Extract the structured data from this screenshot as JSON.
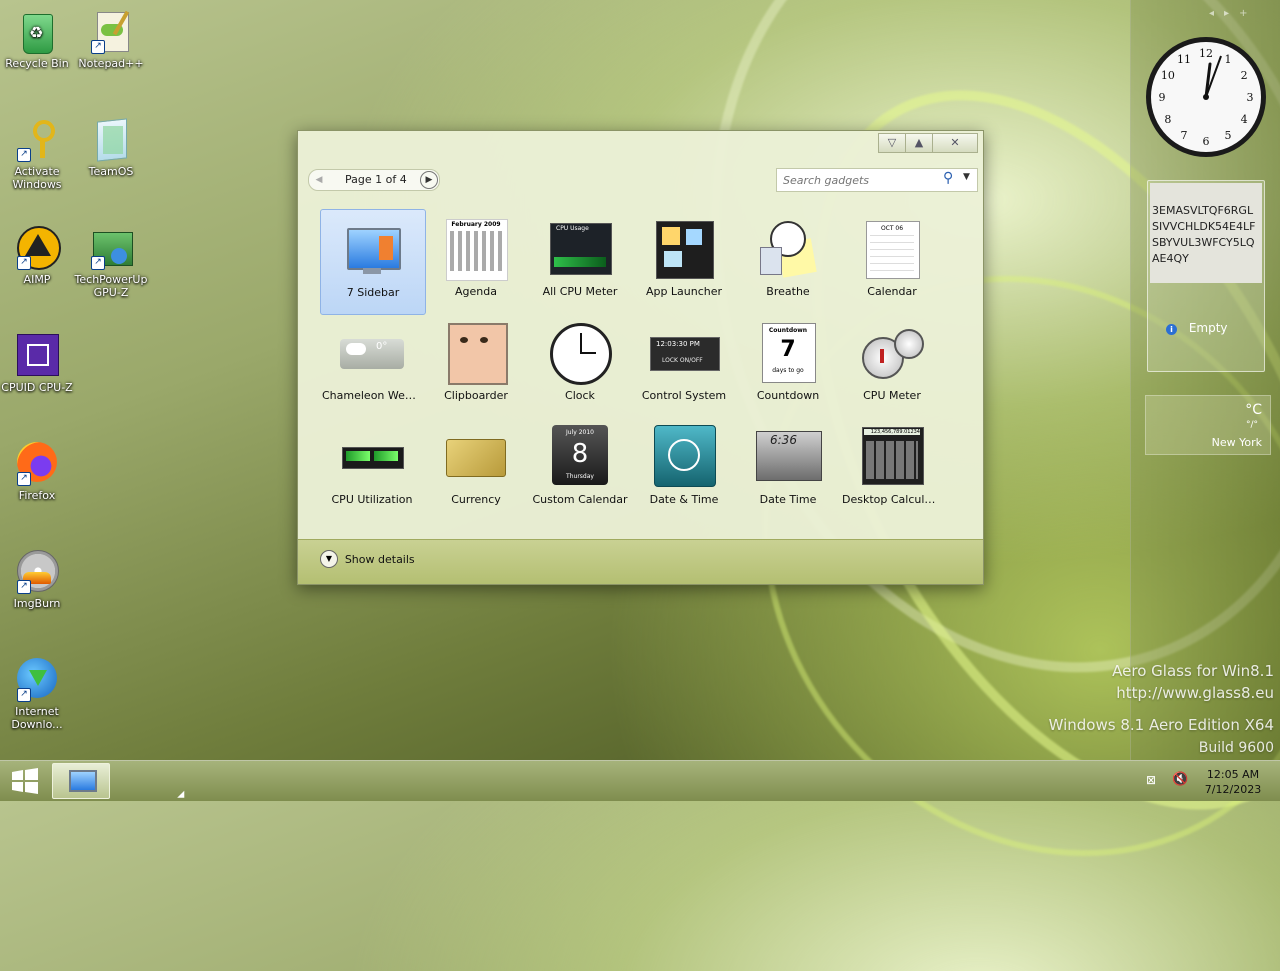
{
  "desktop": {
    "icons": [
      {
        "label": "Recycle Bin"
      },
      {
        "label": "Notepad++"
      },
      {
        "label": "Activate Windows"
      },
      {
        "label": "TeamOS"
      },
      {
        "label": "AIMP"
      },
      {
        "label": "TechPowerUp GPU-Z"
      },
      {
        "label": "CPUID CPU-Z"
      },
      {
        "label": "Firefox"
      },
      {
        "label": "ImgBurn"
      },
      {
        "label": "Internet Downlo..."
      }
    ]
  },
  "gadget_window": {
    "page_label": "Page 1 of 4",
    "search_placeholder": "Search gadgets",
    "gadgets": [
      {
        "label": "7 Sidebar",
        "selected": true
      },
      {
        "label": "Agenda"
      },
      {
        "label": "All CPU Meter"
      },
      {
        "label": "App Launcher"
      },
      {
        "label": "Breathe"
      },
      {
        "label": "Calendar"
      },
      {
        "label": "Chameleon Weat..."
      },
      {
        "label": "Clipboarder"
      },
      {
        "label": "Clock"
      },
      {
        "label": "Control System"
      },
      {
        "label": "Countdown"
      },
      {
        "label": "CPU Meter"
      },
      {
        "label": "CPU Utilization"
      },
      {
        "label": "Currency"
      },
      {
        "label": "Custom Calendar"
      },
      {
        "label": "Date & Time"
      },
      {
        "label": "Date Time"
      },
      {
        "label": "Desktop Calculator"
      }
    ],
    "show_details": "Show details",
    "thumb_text": {
      "agenda_month": "February 2009",
      "cpu_usage": "CPU Usage",
      "weather_temp": "0°",
      "control_time": "12:03:30 PM",
      "control_lock": "LOCK ON/OFF",
      "countdown_title": "Countdown",
      "countdown_num": "7",
      "countdown_sub": "days to go",
      "customcal_month": "July 2010",
      "customcal_num": "8",
      "customcal_day": "Thursday",
      "datetime_digits": "6:36",
      "calc_display": "123,456,789.01234",
      "calendar_month": "OCT 06"
    }
  },
  "sidebar": {
    "clock_numbers": [
      "12",
      "1",
      "2",
      "3",
      "4",
      "5",
      "6",
      "7",
      "8",
      "9",
      "10",
      "11"
    ],
    "notes_text": "3EMASVLTQF6RGLSIVVCHLDK54E4LFSBYVUL3WFCY5LQAE4QY",
    "feed_status": "Empty",
    "weather_unit": "°C",
    "weather_sub": "°/°",
    "weather_city": "New York"
  },
  "watermark": {
    "line1": "Aero Glass for Win8.1",
    "line2": "http://www.glass8.eu",
    "line3": "Windows 8.1 Aero Edition X64",
    "line4": "Build 9600"
  },
  "taskbar": {
    "time": "12:05 AM",
    "date": "7/12/2023"
  }
}
